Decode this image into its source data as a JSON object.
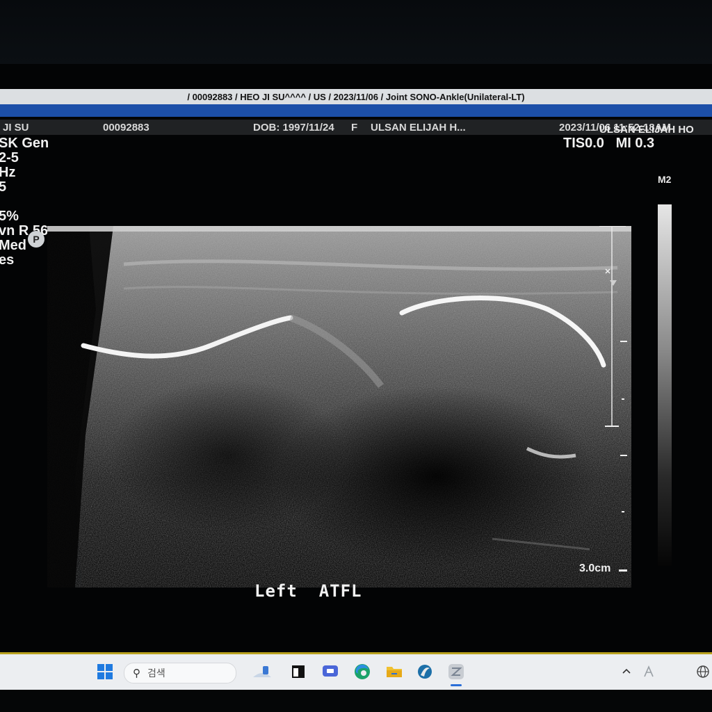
{
  "window": {
    "title": "/ 00092883 / HEO JI SU^^^^ / US / 2023/11/06 / Joint SONO-Ankle(Unilateral-LT)"
  },
  "patient_bar": {
    "name": "JI SU",
    "id": "00092883",
    "dob": "DOB: 1997/11/24",
    "sex": "F",
    "hospital": "ULSAN ELIJAH H...",
    "datetime": "2023/11/06  11:52:18AM"
  },
  "hospital_overlay": "ULSAN ELIJAH HO",
  "acoustic": {
    "tis": "TIS0.0",
    "mi": "MI 0.3"
  },
  "left_params": [
    "SK Gen",
    "2-5",
    "Hz",
    "5",
    "",
    "5%",
    "vn R 56",
    "Med",
    "es"
  ],
  "p_badge": "P",
  "grayscale": {
    "label": "M2"
  },
  "depth": {
    "label": "3.0cm"
  },
  "annotation": {
    "side": "Left",
    "structure": "ATFL"
  },
  "taskbar": {
    "search_placeholder": "검색",
    "icons": [
      "windows-start-icon",
      "search-icon",
      "widget-icon",
      "terminal-icon",
      "video-call-icon",
      "edge-browser-icon",
      "file-explorer-icon",
      "app-icon",
      "zoom-app-icon"
    ],
    "tray": [
      "chevron-up-icon",
      "font-icon",
      "globe-icon"
    ]
  },
  "colors": {
    "title_bg": "#dcdfe2",
    "accent_blue": "#1c4fa8",
    "taskbar_bg": "#eceef1",
    "yellow_line": "#b9a21f"
  }
}
